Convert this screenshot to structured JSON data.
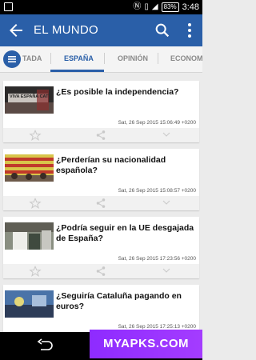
{
  "status_bar": {
    "battery": "83%",
    "time": "3:48"
  },
  "app_bar": {
    "title": "EL MUNDO"
  },
  "tabs": [
    {
      "label": "TADA"
    },
    {
      "label": "ESPAÑA"
    },
    {
      "label": "OPINIÓN"
    },
    {
      "label": "ECONOMÍA"
    }
  ],
  "articles": [
    {
      "headline": "¿Es posible la independencia?",
      "date": "Sat, 26 Sep 2015 15:06:49 +0200",
      "thumb_text": "VIVA ESPAÑA CAT"
    },
    {
      "headline": "¿Perderían su nacionalidad española?",
      "date": "Sat, 26 Sep 2015 15:08:57 +0200"
    },
    {
      "headline": "¿Podría seguir en la UE desgajada de España?",
      "date": "Sat, 26 Sep 2015 17:23:56 +0200"
    },
    {
      "headline": "¿Seguiría Cataluña pagando en euros?",
      "date": "Sat, 26 Sep 2015 17:25:13 +0200"
    }
  ],
  "watermark": "MYAPKS.COM",
  "colors": {
    "primary": "#2a5fa8",
    "watermark": "#9b30ff"
  }
}
